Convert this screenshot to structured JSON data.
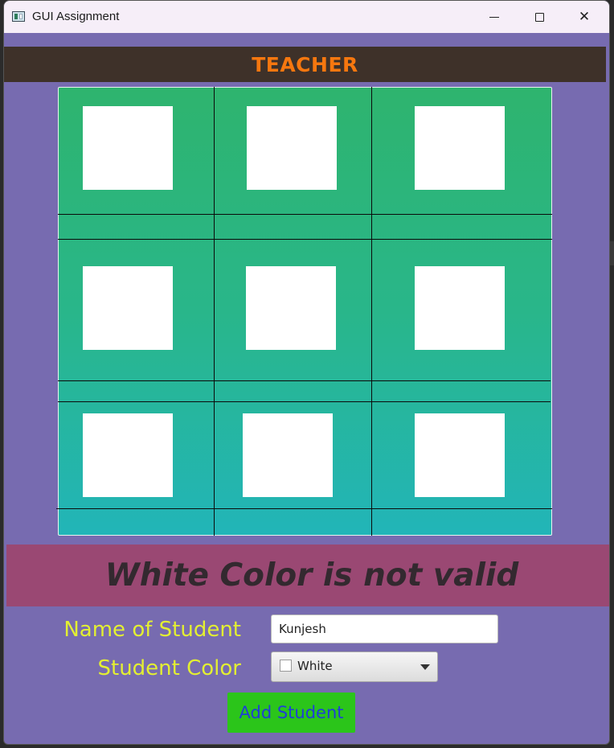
{
  "window": {
    "title": "GUI Assignment",
    "minimize_icon": "minimize-icon",
    "maximize_icon": "maximize-icon",
    "close_icon": "close-icon",
    "close_glyph": "✕"
  },
  "header": {
    "text": "TEACHER",
    "bg_color": "#3e3129",
    "text_color": "#f6770f"
  },
  "grid": {
    "rows": 3,
    "cols": 3,
    "cell_color": "#ffffff",
    "gradient": [
      "#2eb46e",
      "#22b5b8"
    ]
  },
  "message": {
    "text": "White Color is not valid",
    "bg_color": "#9a4873"
  },
  "form": {
    "name_label": "Name of Student",
    "name_value": "Kunjesh",
    "color_label": "Student Color",
    "color_value": "White",
    "add_button": "Add Student"
  },
  "colors": {
    "window_bg": "#776bb0",
    "label_color": "#e3ef32",
    "button_bg": "#2bc51a",
    "button_text": "#1f3fd6"
  }
}
